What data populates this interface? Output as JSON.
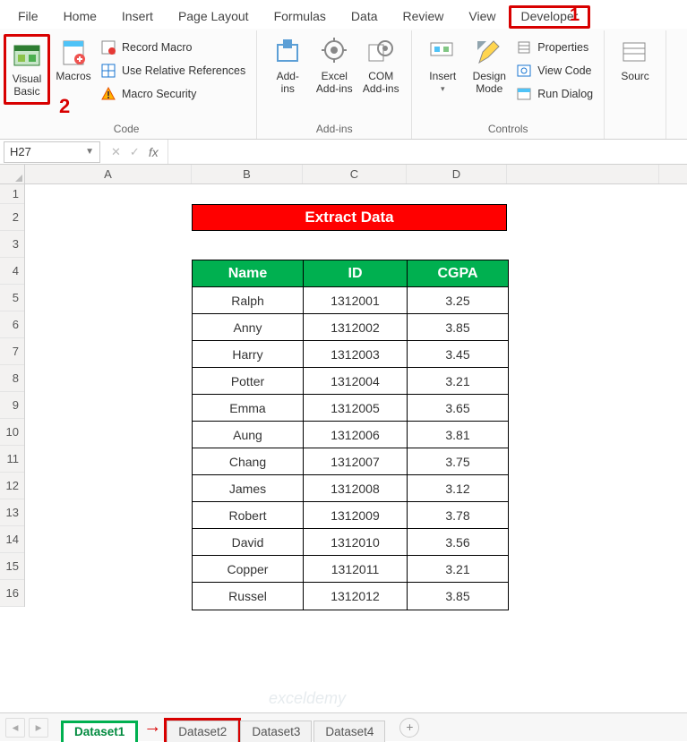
{
  "ribbon": {
    "tabs": [
      "File",
      "Home",
      "Insert",
      "Page Layout",
      "Formulas",
      "Data",
      "Review",
      "View",
      "Developer"
    ],
    "active_tab_index": 8,
    "annotation1": "1",
    "annotation2": "2",
    "groups": {
      "code": {
        "label": "Code",
        "visual_basic": "Visual\nBasic",
        "macros": "Macros",
        "record_macro": "Record Macro",
        "use_relative": "Use Relative References",
        "macro_security": "Macro Security"
      },
      "addins": {
        "label": "Add-ins",
        "addins": "Add-\nins",
        "excel_addins": "Excel\nAdd-ins",
        "com_addins": "COM\nAdd-ins"
      },
      "controls": {
        "label": "Controls",
        "insert": "Insert",
        "design_mode": "Design\nMode",
        "properties": "Properties",
        "view_code": "View Code",
        "run_dialog": "Run Dialog"
      },
      "partial": {
        "source": "Sourc"
      }
    }
  },
  "namebox": {
    "value": "H27"
  },
  "fx": {
    "cancel": "✕",
    "confirm": "✓",
    "fx": "fx"
  },
  "columns": [
    "A",
    "B",
    "C",
    "D"
  ],
  "rows": [
    "1",
    "2",
    "3",
    "4",
    "5",
    "6",
    "7",
    "8",
    "9",
    "10",
    "11",
    "12",
    "13",
    "14",
    "15",
    "16"
  ],
  "title": "Extract Data",
  "table": {
    "headers": [
      "Name",
      "ID",
      "CGPA"
    ],
    "rows": [
      [
        "Ralph",
        "1312001",
        "3.25"
      ],
      [
        "Anny",
        "1312002",
        "3.85"
      ],
      [
        "Harry",
        "1312003",
        "3.45"
      ],
      [
        "Potter",
        "1312004",
        "3.21"
      ],
      [
        "Emma",
        "1312005",
        "3.65"
      ],
      [
        "Aung",
        "1312006",
        "3.81"
      ],
      [
        "Chang",
        "1312007",
        "3.75"
      ],
      [
        "James",
        "1312008",
        "3.12"
      ],
      [
        "Robert",
        "1312009",
        "3.78"
      ],
      [
        "David",
        "1312010",
        "3.56"
      ],
      [
        "Copper",
        "1312011",
        "3.21"
      ],
      [
        "Russel",
        "1312012",
        "3.85"
      ]
    ]
  },
  "sheets": {
    "items": [
      "Dataset1",
      "Dataset2",
      "Dataset3",
      "Dataset4"
    ],
    "active_index": 0,
    "arrow": "→",
    "add": "+"
  },
  "watermark": "exceldemy"
}
